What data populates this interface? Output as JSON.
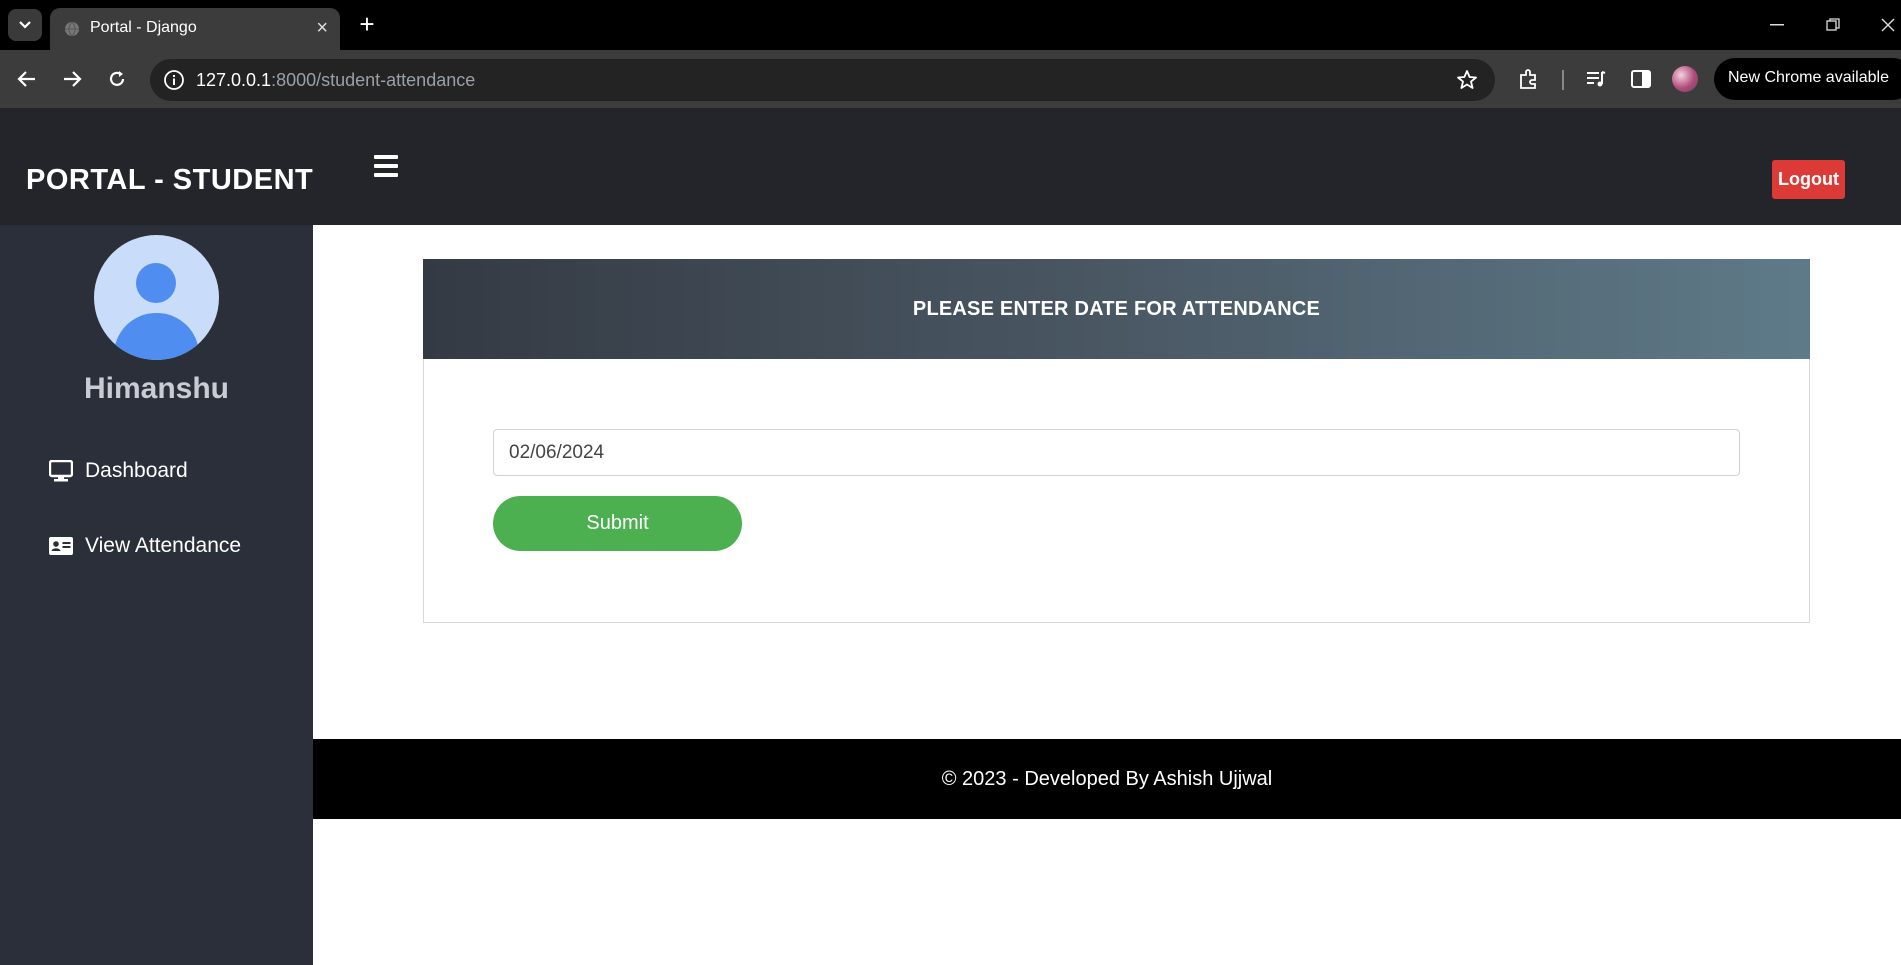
{
  "browser": {
    "tab_title": "Portal - Django",
    "tab_close": "×",
    "new_tab": "+",
    "url_host": "127.0.0.1",
    "url_rest": ":8000/student-attendance",
    "update_label": "New Chrome available"
  },
  "header": {
    "brand": "PORTAL - STUDENT",
    "logout_label": "Logout"
  },
  "sidebar": {
    "user_name": "Himanshu",
    "items": [
      {
        "label": "Dashboard",
        "icon": "monitor-icon"
      },
      {
        "label": "View Attendance",
        "icon": "id-card-icon"
      }
    ]
  },
  "main": {
    "card_title": "PLEASE ENTER DATE FOR ATTENDANCE",
    "date_value": "02/06/2024",
    "submit_label": "Submit"
  },
  "footer": {
    "text": "© 2023 - Developed By Ashish Ujjwal"
  },
  "colors": {
    "header_bg": "#23252b",
    "sidebar_bg": "#2b2f3a",
    "logout": "#dc3a37",
    "submit": "#4caf50"
  }
}
